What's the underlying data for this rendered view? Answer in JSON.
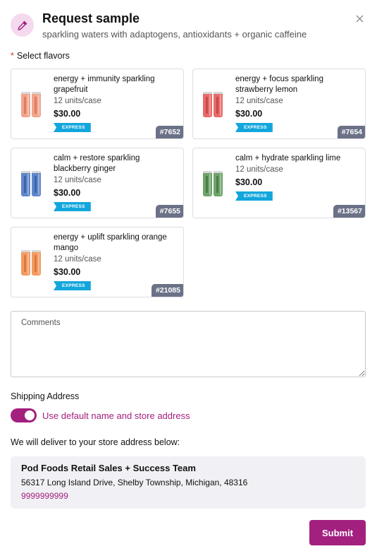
{
  "header": {
    "title": "Request sample",
    "subtitle": "sparkling waters with adaptogens, antioxidants + organic caffeine",
    "icon": "pipette-icon",
    "close_icon": "close-icon"
  },
  "flavors_field": {
    "required_mark": "*",
    "label": "Select flavors"
  },
  "products": [
    {
      "name": "energy + immunity sparkling grapefruit",
      "units": "12 units/case",
      "price": "$30.00",
      "badge": "EXPRESS",
      "sku": "#7652",
      "can_color": "#f0a58c",
      "can_accent": "#e27a5f"
    },
    {
      "name": "energy + focus sparkling strawberry lemon",
      "units": "12 units/case",
      "price": "$30.00",
      "badge": "EXPRESS",
      "sku": "#7654",
      "can_color": "#e86a6a",
      "can_accent": "#c94848"
    },
    {
      "name": "calm + restore sparkling blackberry ginger",
      "units": "12 units/case",
      "price": "$30.00",
      "badge": "EXPRESS",
      "sku": "#7655",
      "can_color": "#5f86c9",
      "can_accent": "#3e63a8"
    },
    {
      "name": "calm + hydrate sparkling lime",
      "units": "12 units/case",
      "price": "$30.00",
      "badge": "EXPRESS",
      "sku": "#13567",
      "can_color": "#6ea36a",
      "can_accent": "#4b7d47"
    },
    {
      "name": "energy + uplift sparkling orange mango",
      "units": "12 units/case",
      "price": "$30.00",
      "badge": "EXPRESS",
      "sku": "#21085",
      "can_color": "#f29b62",
      "can_accent": "#dd7a3d"
    }
  ],
  "comments": {
    "placeholder": "Comments",
    "value": ""
  },
  "shipping": {
    "label": "Shipping Address",
    "toggle_on": true,
    "toggle_label": "Use default name and store address",
    "deliver_text": "We will deliver to your store address below:",
    "name": "Pod Foods Retail Sales + Success Team",
    "address": "56317 Long Island Drive, Shelby Township, Michigan, 48316",
    "phone": "9999999999"
  },
  "submit_label": "Submit",
  "colors": {
    "accent": "#a3207f",
    "express": "#13a6dd",
    "sku_badge": "#6b7287",
    "icon_bg": "#f5d9ef"
  }
}
